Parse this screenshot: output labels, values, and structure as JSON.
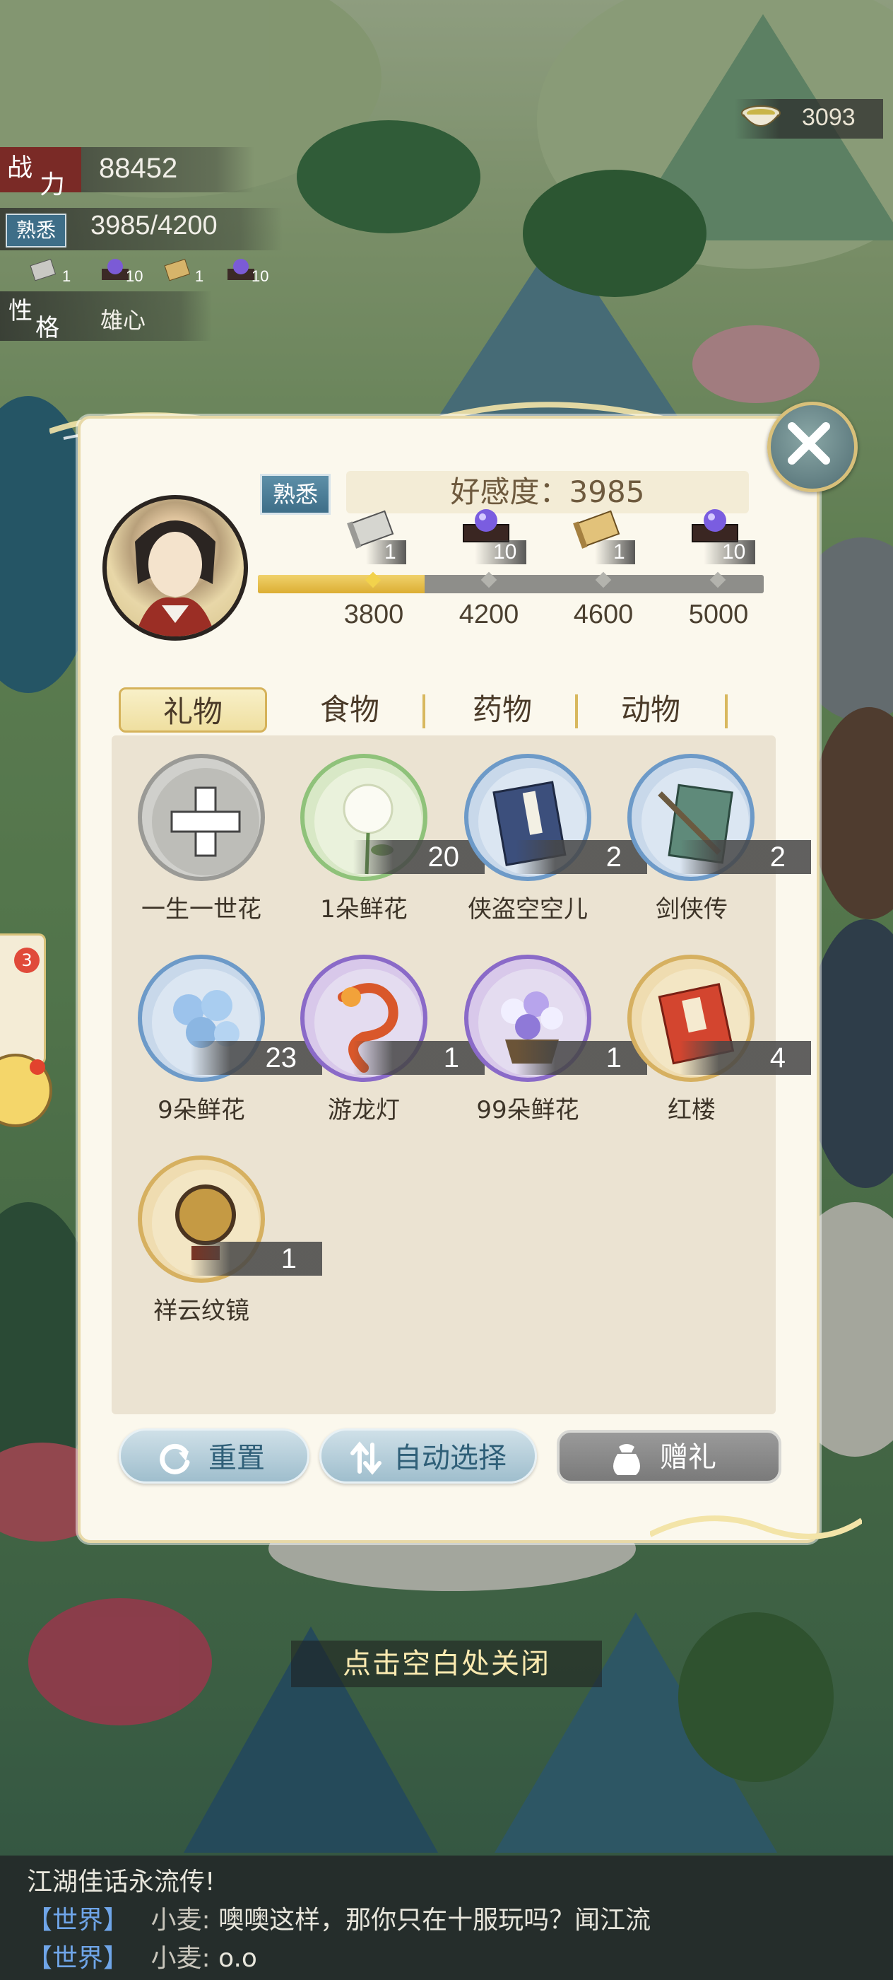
{
  "hud": {
    "power_label_a": "战",
    "power_label_b": "力",
    "power_value": "88452",
    "familiarity_badge": "熟悉",
    "familiarity_value": "3985/4200",
    "trait_label_a": "性",
    "trait_label_b": "格",
    "trait_value": "雄心",
    "mini_rewards": [
      "1",
      "10",
      "1",
      "10"
    ],
    "coin_value": "3093"
  },
  "dialog": {
    "rank_badge": "熟悉",
    "affinity_text": "好感度：3985",
    "progress_fraction": 0.33,
    "milestones": [
      {
        "threshold": "3800",
        "qty": "1",
        "icon": "silver-scroll-icon"
      },
      {
        "threshold": "4200",
        "qty": "10",
        "icon": "purple-orb-chest-icon"
      },
      {
        "threshold": "4600",
        "qty": "1",
        "icon": "gold-scroll-icon"
      },
      {
        "threshold": "5000",
        "qty": "10",
        "icon": "purple-orb-chest-icon"
      }
    ],
    "tabs": [
      "礼物",
      "食物",
      "药物",
      "动物"
    ],
    "items": [
      {
        "name": "一生一世花",
        "qty": "",
        "icon": "locked-cross-icon"
      },
      {
        "name": "1朵鲜花",
        "qty": "20",
        "icon": "white-rose-icon"
      },
      {
        "name": "侠盗空空儿",
        "qty": "2",
        "icon": "blue-book-icon"
      },
      {
        "name": "剑侠传",
        "qty": "2",
        "icon": "sword-book-icon"
      },
      {
        "name": "9朵鲜花",
        "qty": "23",
        "icon": "blue-rose-bouquet-icon"
      },
      {
        "name": "游龙灯",
        "qty": "1",
        "icon": "dragon-lantern-icon"
      },
      {
        "name": "99朵鲜花",
        "qty": "1",
        "icon": "purple-flower-basket-icon"
      },
      {
        "name": "红楼",
        "qty": "4",
        "icon": "red-book-icon"
      },
      {
        "name": "祥云纹镜",
        "qty": "1",
        "icon": "bronze-mirror-icon"
      }
    ],
    "btn_reset": "重置",
    "btn_auto": "自动选择",
    "btn_gift": "赠礼"
  },
  "hint": "点击空白处关闭",
  "side": {
    "badge": "3"
  },
  "chat": {
    "line1": "江湖佳话永流传!",
    "line2_channel": "【世界】",
    "line2_user": "小麦:",
    "line2_text": "噢噢这样，那你只在十服玩吗？闻江流",
    "line3_channel": "【世界】",
    "line3_user": "小麦:",
    "line3_text": "o.o"
  },
  "colors": {
    "accent_gold": "#dcae33",
    "badge_blue": "#3e6e88",
    "chat_channel": "#6fa5e8"
  }
}
